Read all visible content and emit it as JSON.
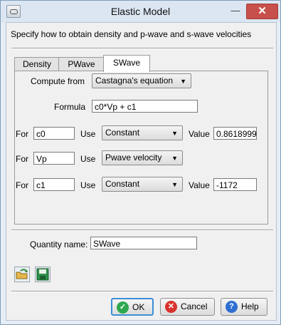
{
  "window": {
    "title": "Elastic Model",
    "minimize_icon": "minimize-icon",
    "close_icon": "close-icon",
    "minimize_glyph": "—",
    "close_glyph": "✕"
  },
  "subtitle": "Specify how to obtain density and p-wave and s-wave velocities",
  "tabs": [
    {
      "label": "Density"
    },
    {
      "label": "PWave"
    },
    {
      "label": "SWave",
      "active": true
    }
  ],
  "compute": {
    "label": "Compute from",
    "value": "Castagna's equation"
  },
  "formula": {
    "label": "Formula",
    "value": "c0*Vp + c1"
  },
  "rows": [
    {
      "for_label": "For",
      "var": "c0",
      "use_label": "Use",
      "use_value": "Constant",
      "value_label": "Value",
      "value": "0.8618999"
    },
    {
      "for_label": "For",
      "var": "Vp",
      "use_label": "Use",
      "use_value": "Pwave velocity"
    },
    {
      "for_label": "For",
      "var": "c1",
      "use_label": "Use",
      "use_value": "Constant",
      "value_label": "Value",
      "value": "-1172"
    }
  ],
  "quantity": {
    "label": "Quantity name:",
    "value": "SWave"
  },
  "tools": {
    "open_icon": "open-folder-icon",
    "save_icon": "save-disk-icon"
  },
  "buttons": {
    "ok": {
      "label": "OK",
      "icon": "checkmark-icon",
      "color": "#2fa84f"
    },
    "cancel": {
      "label": "Cancel",
      "icon": "cancel-icon",
      "color": "#d8322d"
    },
    "help": {
      "label": "Help",
      "icon": "help-icon",
      "color": "#2f6fd1"
    }
  }
}
